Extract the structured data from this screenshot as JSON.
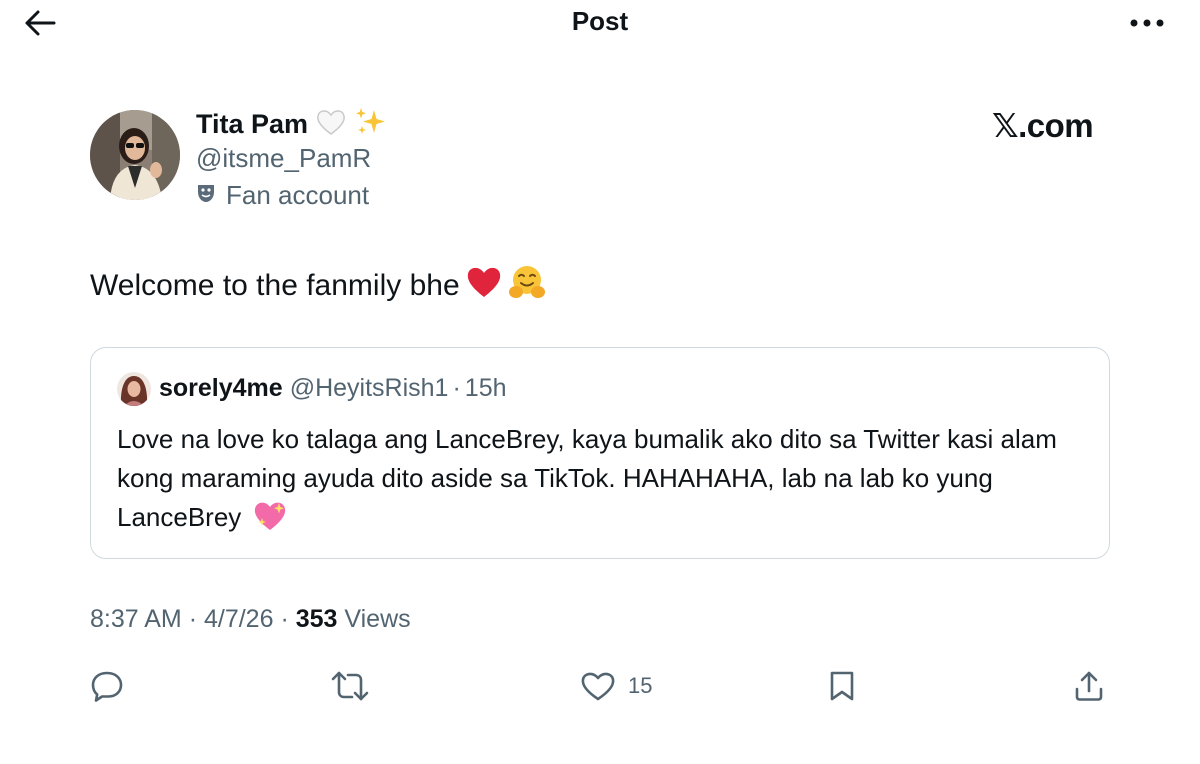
{
  "header": {
    "title": "Post",
    "back_icon": "arrow-left-icon",
    "more_icon": "more-dots-icon"
  },
  "author": {
    "display_name": "Tita Pam",
    "name_emojis": [
      "white-heart-icon",
      "sparkles-icon"
    ],
    "handle": "@itsme_PamR",
    "label": "Fan account",
    "label_icon": "theater-mask-icon"
  },
  "brand": "𝕏.com",
  "post": {
    "text": "Welcome to the fanmily bhe",
    "emojis": [
      "red-heart-icon",
      "hugging-face-icon"
    ]
  },
  "quote": {
    "name": "sorely4me",
    "handle": "@HeyitsRish1",
    "separator": "·",
    "time": "15h",
    "text": "Love na love ko talaga ang LanceBrey, kaya bumalik ako dito sa Twitter kasi alam kong maraming ayuda dito aside sa TikTok. HAHAHAHA, lab na lab ko yung LanceBrey",
    "emoji": "sparkling-heart-icon"
  },
  "meta": {
    "time": "8:37 AM",
    "sep": "·",
    "date": "4/7/26",
    "views_count": "353",
    "views_label": "Views"
  },
  "actions": {
    "reply_icon": "reply-icon",
    "repost_icon": "repost-icon",
    "like_icon": "heart-icon",
    "like_count": "15",
    "bookmark_icon": "bookmark-icon",
    "share_icon": "share-icon"
  },
  "colors": {
    "text": "#0f1419",
    "secondary": "#536471",
    "border": "#cfd9de",
    "heart": "#e0243b",
    "emoji_yellow": "#f9c437"
  }
}
